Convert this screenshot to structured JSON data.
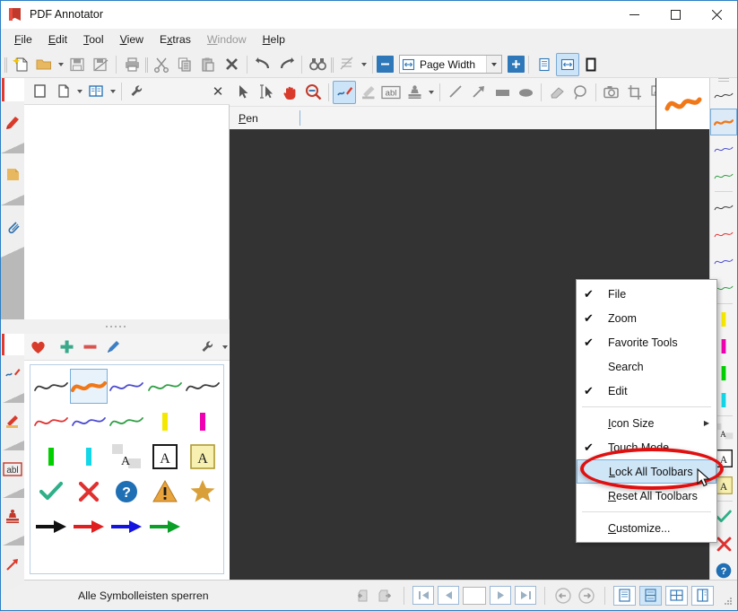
{
  "window": {
    "title": "PDF Annotator",
    "logo_icon": "pdf-annotator-bookmark-logo",
    "minimize_label": "—",
    "maximize_label": "☐",
    "close_label": "✕"
  },
  "menubar": {
    "items": [
      {
        "label": "File",
        "accel": "F",
        "disabled": false
      },
      {
        "label": "Edit",
        "accel": "E",
        "disabled": false
      },
      {
        "label": "Tool",
        "accel": "T",
        "disabled": false
      },
      {
        "label": "View",
        "accel": "V",
        "disabled": false
      },
      {
        "label": "Extras",
        "accel": "x",
        "disabled": false
      },
      {
        "label": "Window",
        "accel": "W",
        "disabled": true
      },
      {
        "label": "Help",
        "accel": "H",
        "disabled": false
      }
    ]
  },
  "main_toolbar": {
    "buttons": [
      {
        "name": "new-document-button",
        "icon": "new-document-icon"
      },
      {
        "name": "open-document-button",
        "icon": "open-folder-icon"
      },
      {
        "name": "save-button",
        "icon": "save-disk-icon"
      },
      {
        "name": "save-as-button",
        "icon": "save-as-icon"
      },
      {
        "name": "print-button",
        "icon": "printer-icon"
      },
      {
        "name": "cut-button",
        "icon": "scissors-icon"
      },
      {
        "name": "copy-button",
        "icon": "copy-icon"
      },
      {
        "name": "paste-button",
        "icon": "paste-icon"
      },
      {
        "name": "delete-button",
        "icon": "delete-x-icon"
      },
      {
        "name": "undo-button",
        "icon": "undo-arrow-icon"
      },
      {
        "name": "redo-button",
        "icon": "redo-arrow-icon"
      },
      {
        "name": "find-button",
        "icon": "binoculars-icon"
      },
      {
        "name": "page-sort-button",
        "icon": "page-sort-icon"
      }
    ],
    "zoom": {
      "out_label": "−",
      "in_label": "+",
      "value": "Page Width",
      "icon": "page-width-icon",
      "dropdown_icon": "chevron-down-icon"
    },
    "view_modes": [
      {
        "name": "single-page-view-button",
        "icon": "single-page-icon",
        "active": false
      },
      {
        "name": "page-width-view-button",
        "icon": "page-width-view-icon",
        "active": true
      },
      {
        "name": "full-screen-view-button",
        "icon": "fullscreen-icon",
        "active": false
      }
    ]
  },
  "left_rail": {
    "tabs": [
      {
        "name": "sidebar-tab-bookmarks",
        "icon": "bookmark-icon"
      },
      {
        "name": "sidebar-tab-pages",
        "icon": "page-note-icon"
      },
      {
        "name": "sidebar-tab-attachments",
        "icon": "paperclip-icon"
      }
    ]
  },
  "left_panel": {
    "toolbar": [
      {
        "name": "panel-thumbnail-button",
        "icon": "blank-square-icon"
      },
      {
        "name": "panel-page-button",
        "icon": "page-icon"
      },
      {
        "name": "panel-book-button",
        "icon": "book-icon"
      },
      {
        "name": "panel-settings-button",
        "icon": "wrench-icon"
      }
    ],
    "close_label": "✕"
  },
  "favorites_panel": {
    "header": {
      "heart_icon": "heart-favorite-icon",
      "add_label": "+",
      "remove_label": "−",
      "edit_icon": "pencil-edit-icon",
      "settings_icon": "wrench-icon"
    },
    "items": [
      {
        "name": "favorite-pen-black",
        "icon": "squiggle",
        "color": "#3a3a3a",
        "selected": false
      },
      {
        "name": "favorite-pen-orange",
        "icon": "squiggle-thick",
        "color": "#f07818",
        "selected": true
      },
      {
        "name": "favorite-pen-blue",
        "icon": "squiggle",
        "color": "#4a4ad0",
        "selected": false
      },
      {
        "name": "favorite-pen-green",
        "icon": "squiggle",
        "color": "#2f9e44",
        "selected": false
      },
      {
        "name": "favorite-pen-black-2",
        "icon": "squiggle",
        "color": "#3a3a3a",
        "selected": false
      },
      {
        "name": "favorite-pen-red",
        "icon": "squiggle",
        "color": "#e03131",
        "selected": false
      },
      {
        "name": "favorite-pen-blue-2",
        "icon": "squiggle",
        "color": "#4a4ad0",
        "selected": false
      },
      {
        "name": "favorite-pen-green-2",
        "icon": "squiggle",
        "color": "#2f9e44",
        "selected": false
      },
      {
        "name": "favorite-highlighter-yellow",
        "icon": "bar",
        "color": "#f5e800",
        "selected": false
      },
      {
        "name": "favorite-highlighter-magenta",
        "icon": "bar",
        "color": "#ef00b0",
        "selected": false
      },
      {
        "name": "favorite-highlighter-green",
        "icon": "bar",
        "color": "#00d000",
        "selected": false
      },
      {
        "name": "favorite-highlighter-cyan",
        "icon": "bar",
        "color": "#12d7e8",
        "selected": false
      },
      {
        "name": "favorite-text-plain",
        "icon": "text-plain",
        "color": "#1a1a1a",
        "selected": false
      },
      {
        "name": "favorite-text-boxed",
        "icon": "text-boxed",
        "color": "#1a1a1a",
        "selected": false
      },
      {
        "name": "favorite-text-note",
        "icon": "text-note",
        "color": "#1a1a1a",
        "selected": false
      },
      {
        "name": "favorite-stamp-check",
        "icon": "check",
        "color": "#2fb089",
        "selected": false
      },
      {
        "name": "favorite-stamp-cross",
        "icon": "cross",
        "color": "#e03131",
        "selected": false
      },
      {
        "name": "favorite-stamp-question",
        "icon": "question",
        "color": "#1f6fb5",
        "selected": false
      },
      {
        "name": "favorite-stamp-warning",
        "icon": "warning",
        "color": "#e8a33d",
        "selected": false
      },
      {
        "name": "favorite-stamp-star",
        "icon": "star",
        "color": "#d9a03a",
        "selected": false
      },
      {
        "name": "favorite-arrow-black",
        "icon": "arrow",
        "color": "#111111",
        "selected": false
      },
      {
        "name": "favorite-arrow-red",
        "icon": "arrow",
        "color": "#e02020",
        "selected": false
      },
      {
        "name": "favorite-arrow-blue",
        "icon": "arrow",
        "color": "#1414e0",
        "selected": false
      },
      {
        "name": "favorite-arrow-green",
        "icon": "arrow",
        "color": "#0aa028",
        "selected": false
      }
    ]
  },
  "left_rail_bottom": {
    "tabs": [
      {
        "name": "tool-rail-pen",
        "icon": "pen-icon"
      },
      {
        "name": "tool-rail-highlighter",
        "icon": "highlighter-icon"
      },
      {
        "name": "tool-rail-textbox",
        "icon": "textbox-abl-icon"
      },
      {
        "name": "tool-rail-stamp",
        "icon": "stamp-icon"
      },
      {
        "name": "tool-rail-arrow",
        "icon": "arrow-icon"
      }
    ]
  },
  "annotation_toolbar": {
    "buttons": [
      {
        "name": "select-tool",
        "icon": "cursor-arrow-icon",
        "active": false
      },
      {
        "name": "text-select-tool",
        "icon": "text-select-icon",
        "active": false
      },
      {
        "name": "hand-tool",
        "icon": "hand-icon",
        "active": false
      },
      {
        "name": "magnify-tool",
        "icon": "magnifier-icon",
        "active": false
      },
      {
        "name": "pen-tool",
        "icon": "pen-icon",
        "active": true
      },
      {
        "name": "highlighter-tool",
        "icon": "highlighter-icon",
        "active": false
      },
      {
        "name": "textbox-tool",
        "icon": "textbox-abl-icon",
        "active": false
      },
      {
        "name": "stamp-tool",
        "icon": "stamp-icon",
        "active": false
      },
      {
        "name": "line-tool",
        "icon": "line-icon",
        "active": false
      },
      {
        "name": "arrow-tool",
        "icon": "arrow-icon",
        "active": false
      },
      {
        "name": "rectangle-tool",
        "icon": "rectangle-icon",
        "active": false
      },
      {
        "name": "ellipse-tool",
        "icon": "ellipse-icon",
        "active": false
      },
      {
        "name": "eraser-tool",
        "icon": "eraser-icon",
        "active": false
      },
      {
        "name": "lasso-tool",
        "icon": "lasso-icon",
        "active": false
      },
      {
        "name": "snapshot-tool",
        "icon": "camera-icon",
        "active": false
      },
      {
        "name": "crop-tool",
        "icon": "crop-icon",
        "active": false
      },
      {
        "name": "insert-image-tool",
        "icon": "insert-image-icon",
        "active": false
      }
    ],
    "overflow_icon": "chevron-down-icon"
  },
  "tool_options_bar": {
    "label": "Pen",
    "accel": "P"
  },
  "pen_preview": {
    "icon": "orange-squiggle-preview",
    "color": "#f07818"
  },
  "right_rail": {
    "items": [
      {
        "name": "quickbar-pen-black",
        "icon": "squiggle",
        "color": "#3a3a3a",
        "selected": false
      },
      {
        "name": "quickbar-pen-orange",
        "icon": "squiggle-thick",
        "color": "#f07818",
        "selected": true
      },
      {
        "name": "quickbar-pen-blue",
        "icon": "squiggle",
        "color": "#4a4ad0",
        "selected": false
      },
      {
        "name": "quickbar-pen-green",
        "icon": "squiggle",
        "color": "#2f9e44",
        "selected": false
      },
      {
        "name": "quickbar-pen-black-2",
        "icon": "squiggle",
        "color": "#3a3a3a",
        "selected": false
      },
      {
        "name": "quickbar-pen-red",
        "icon": "squiggle",
        "color": "#e03131",
        "selected": false
      },
      {
        "name": "quickbar-pen-blue-2",
        "icon": "squiggle",
        "color": "#4a4ad0",
        "selected": false
      },
      {
        "name": "quickbar-pen-green-2",
        "icon": "squiggle",
        "color": "#2f9e44",
        "selected": false
      },
      {
        "name": "quickbar-highlighter-yellow",
        "icon": "bar",
        "color": "#f5e800",
        "selected": false
      },
      {
        "name": "quickbar-highlighter-magenta",
        "icon": "bar",
        "color": "#ef00b0",
        "selected": false
      },
      {
        "name": "quickbar-highlighter-green",
        "icon": "bar",
        "color": "#00d000",
        "selected": false
      },
      {
        "name": "quickbar-highlighter-cyan",
        "icon": "bar",
        "color": "#12d7e8",
        "selected": false
      },
      {
        "name": "quickbar-text-plain",
        "icon": "text-plain",
        "color": "#1a1a1a",
        "selected": false
      },
      {
        "name": "quickbar-text-boxed",
        "icon": "text-boxed",
        "color": "#1a1a1a",
        "selected": false
      },
      {
        "name": "quickbar-text-note",
        "icon": "text-note",
        "color": "#1a1a1a",
        "selected": false
      },
      {
        "name": "quickbar-stamp-check",
        "icon": "check",
        "color": "#2fb089",
        "selected": false
      },
      {
        "name": "quickbar-stamp-cross",
        "icon": "cross",
        "color": "#e03131",
        "selected": false
      },
      {
        "name": "quickbar-stamp-question",
        "icon": "question",
        "color": "#1f6fb5",
        "selected": false
      }
    ],
    "more_label": "›"
  },
  "context_menu": {
    "items": [
      {
        "label": "File",
        "accel": "",
        "checked": true,
        "submenu": false,
        "highlighted": false,
        "separator_after": false
      },
      {
        "label": "Zoom",
        "accel": "",
        "checked": true,
        "submenu": false,
        "highlighted": false,
        "separator_after": false
      },
      {
        "label": "Favorite Tools",
        "accel": "",
        "checked": true,
        "submenu": false,
        "highlighted": false,
        "separator_after": false
      },
      {
        "label": "Search",
        "accel": "",
        "checked": false,
        "submenu": false,
        "highlighted": false,
        "separator_after": false
      },
      {
        "label": "Edit",
        "accel": "",
        "checked": true,
        "submenu": false,
        "highlighted": false,
        "separator_after": true
      },
      {
        "label": "Icon Size",
        "accel": "I",
        "checked": false,
        "submenu": true,
        "highlighted": false,
        "separator_after": false
      },
      {
        "label": "Touch Mode",
        "accel": "T",
        "checked": true,
        "submenu": false,
        "highlighted": false,
        "separator_after": false
      },
      {
        "label": "Lock All Toolbars",
        "accel": "L",
        "checked": false,
        "submenu": false,
        "highlighted": true,
        "separator_after": false
      },
      {
        "label": "Reset All Toolbars",
        "accel": "R",
        "checked": false,
        "submenu": false,
        "highlighted": false,
        "separator_after": true
      },
      {
        "label": "Customize...",
        "accel": "C",
        "checked": false,
        "submenu": false,
        "highlighted": false,
        "separator_after": false
      }
    ],
    "check_glyph": "✔",
    "submenu_glyph": "▶"
  },
  "annotation_overlay": {
    "ellipse_color": "#e01010",
    "target_label": "Lock All Toolbars"
  },
  "status_bar": {
    "hint_text": "Alle Symbolleisten sperren",
    "nav_buttons": [
      {
        "name": "previous-view-button",
        "icon": "prev-view-icon"
      },
      {
        "name": "next-view-button",
        "icon": "next-view-icon"
      }
    ],
    "page_nav": [
      {
        "name": "first-page-button",
        "icon": "first-page-icon"
      },
      {
        "name": "previous-page-button",
        "icon": "previous-page-icon"
      }
    ],
    "page_number": "",
    "page_nav_right": [
      {
        "name": "next-page-button",
        "icon": "next-page-icon"
      },
      {
        "name": "last-page-button",
        "icon": "last-page-icon"
      }
    ],
    "history": [
      {
        "name": "back-button",
        "icon": "back-circle-icon"
      },
      {
        "name": "forward-button",
        "icon": "forward-circle-icon"
      }
    ],
    "layout_modes": [
      {
        "name": "layout-single-button",
        "icon": "layout-single-icon",
        "active": false
      },
      {
        "name": "layout-continuous-button",
        "icon": "layout-continuous-icon",
        "active": true
      },
      {
        "name": "layout-facing-button",
        "icon": "layout-facing-icon",
        "active": false
      },
      {
        "name": "layout-columns-button",
        "icon": "layout-columns-icon",
        "active": false
      }
    ]
  }
}
